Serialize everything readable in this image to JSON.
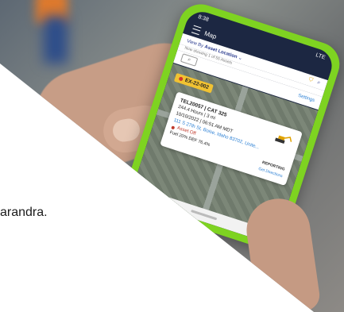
{
  "phone": {
    "status": {
      "time": "8:38",
      "signal": "LTE"
    },
    "title": "Map",
    "view_by": {
      "prefix": "View By",
      "value": "Asset Location",
      "chevron": "chevron-down-icon"
    },
    "subtitle": "Now showing 1 of 55 Assets",
    "settings_label": "Settings",
    "pin_label": "EX-22-002",
    "popup": {
      "line1": "TEL20057 | CAT 325",
      "line2": "244.4 Hours | 3 mi",
      "line3": "10/10/2022 | 06:51 AM MDT",
      "address": "111 S 27th St, Boise, Idaho 83702, Unite...",
      "status": "Asset Off",
      "fuel": "Fuel 20%",
      "def": "DEF 76.4%",
      "reporting": "REPORTING",
      "directions": "Get Directions"
    },
    "side_badge": "1"
  },
  "caption": "arandra.",
  "colors": {
    "phone_case": "#7ed321",
    "pin": "#f1c232",
    "link": "#2a7fd4",
    "status_off": "#c0392b"
  }
}
